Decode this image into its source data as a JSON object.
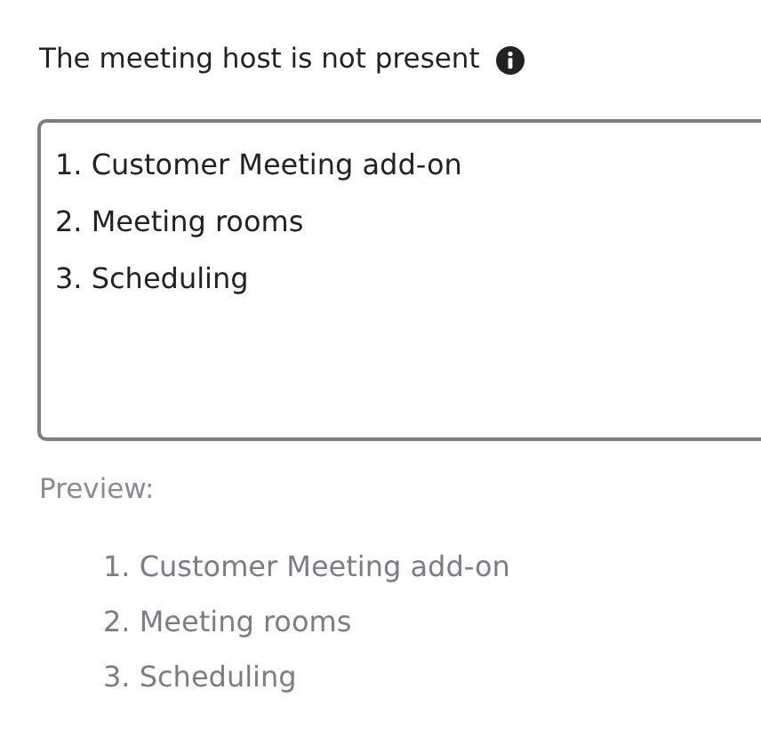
{
  "field": {
    "label": "The meeting host is not present",
    "lines": [
      "1. Customer Meeting add-on",
      "2. Meeting rooms",
      "3. Scheduling"
    ]
  },
  "preview": {
    "label": "Preview:",
    "items": [
      "1. Customer Meeting add-on",
      "2. Meeting rooms",
      "3. Scheduling"
    ]
  }
}
